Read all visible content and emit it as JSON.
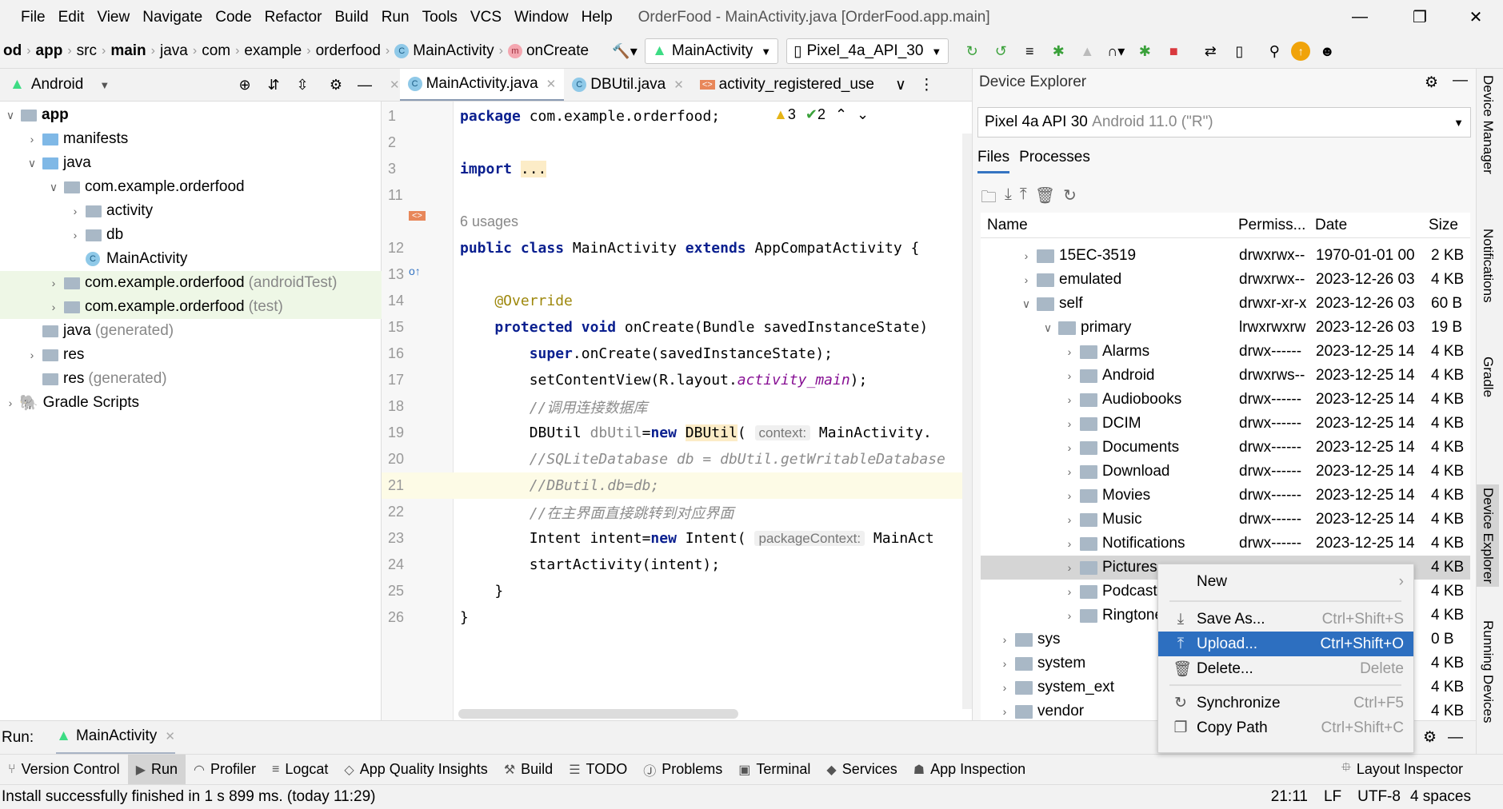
{
  "menu": [
    "File",
    "Edit",
    "View",
    "Navigate",
    "Code",
    "Refactor",
    "Build",
    "Run",
    "Tools",
    "VCS",
    "Window",
    "Help"
  ],
  "window_title": "OrderFood - MainActivity.java [OrderFood.app.main]",
  "breadcrumb": [
    "od",
    "app",
    "src",
    "main",
    "java",
    "com",
    "example",
    "orderfood",
    "MainActivity",
    "onCreate"
  ],
  "run_config": "MainActivity",
  "device": "Pixel_4a_API_30",
  "project": {
    "view": "Android",
    "tree": [
      {
        "label": "app",
        "depth": 0,
        "chev": "open",
        "icon": "module",
        "bold": true
      },
      {
        "label": "manifests",
        "depth": 1,
        "chev": "closed",
        "icon": "folder-blue"
      },
      {
        "label": "java",
        "depth": 1,
        "chev": "open",
        "icon": "folder-blue"
      },
      {
        "label": "com.example.orderfood",
        "depth": 2,
        "chev": "open",
        "icon": "package"
      },
      {
        "label": "activity",
        "depth": 3,
        "chev": "closed",
        "icon": "package"
      },
      {
        "label": "db",
        "depth": 3,
        "chev": "closed",
        "icon": "package"
      },
      {
        "label": "MainActivity",
        "depth": 3,
        "chev": "",
        "icon": "class"
      },
      {
        "label": "com.example.orderfood",
        "suffix": "(androidTest)",
        "depth": 2,
        "chev": "closed",
        "icon": "package",
        "hl": true
      },
      {
        "label": "com.example.orderfood",
        "suffix": "(test)",
        "depth": 2,
        "chev": "closed",
        "icon": "package",
        "hl": true
      },
      {
        "label": "java",
        "suffix": "(generated)",
        "depth": 1,
        "chev": "",
        "icon": "folder-gen"
      },
      {
        "label": "res",
        "depth": 1,
        "chev": "closed",
        "icon": "folder-res"
      },
      {
        "label": "res",
        "suffix": "(generated)",
        "depth": 1,
        "chev": "",
        "icon": "folder-res"
      },
      {
        "label": "Gradle Scripts",
        "depth": 0,
        "chev": "closed",
        "icon": "gradle"
      }
    ]
  },
  "editor": {
    "tabs": [
      {
        "label": "MainActivity.java",
        "active": true
      },
      {
        "label": "DBUtil.java"
      },
      {
        "label": "activity_registered_use"
      }
    ],
    "inspections": {
      "warnings": "3",
      "ok": "2"
    },
    "lines": [
      {
        "n": "1",
        "t": [
          [
            "package ",
            "kw"
          ],
          [
            "com.example.orderfood;",
            ""
          ]
        ]
      },
      {
        "n": "2",
        "t": []
      },
      {
        "n": "3",
        "t": [
          [
            "import ",
            "kw"
          ],
          [
            "...",
            "hlw"
          ]
        ]
      },
      {
        "n": "11",
        "t": []
      },
      {
        "n": "",
        "t": [
          [
            "6 usages",
            "usage"
          ]
        ]
      },
      {
        "n": "12",
        "t": [
          [
            "public ",
            "kw"
          ],
          [
            "class ",
            "kw"
          ],
          [
            "MainActivity ",
            ""
          ],
          [
            "extends ",
            "kw"
          ],
          [
            "AppCompatActivity {",
            ""
          ]
        ]
      },
      {
        "n": "13",
        "t": []
      },
      {
        "n": "14",
        "t": [
          [
            "    @Override",
            "ann"
          ]
        ]
      },
      {
        "n": "15",
        "t": [
          [
            "    ",
            ""
          ],
          [
            "protected ",
            "kw"
          ],
          [
            "void ",
            "kw"
          ],
          [
            "onCreate(Bundle savedInstanceState)",
            ""
          ]
        ]
      },
      {
        "n": "16",
        "t": [
          [
            "        ",
            ""
          ],
          [
            "super",
            "kw"
          ],
          [
            ".onCreate(savedInstanceState);",
            ""
          ]
        ]
      },
      {
        "n": "17",
        "t": [
          [
            "        setContentView(R.layout.",
            ""
          ],
          [
            "activity_main",
            "fld"
          ],
          [
            ");",
            ""
          ]
        ]
      },
      {
        "n": "18",
        "t": [
          [
            "        //调用连接数据库",
            "cmt"
          ]
        ]
      },
      {
        "n": "19",
        "t": [
          [
            "        DBUtil ",
            ""
          ],
          [
            "dbUtil",
            "var"
          ],
          [
            "=",
            ""
          ],
          [
            "new ",
            "kw"
          ],
          [
            "DBUtil",
            "hlw"
          ],
          [
            "( ",
            ""
          ],
          [
            "context:",
            "hint"
          ],
          [
            " MainActivity.",
            ""
          ]
        ]
      },
      {
        "n": "20",
        "t": [
          [
            "        //SQLiteDatabase db = dbUtil.getWritableDatabase",
            "cmt"
          ]
        ]
      },
      {
        "n": "21",
        "t": [
          [
            "        //DButil.db=db;",
            "cmt"
          ]
        ],
        "cur": true
      },
      {
        "n": "22",
        "t": [
          [
            "        //在主界面直接跳转到对应界面",
            "cmt"
          ]
        ]
      },
      {
        "n": "23",
        "t": [
          [
            "        Intent intent=",
            ""
          ],
          [
            "new ",
            "kw"
          ],
          [
            "Intent( ",
            ""
          ],
          [
            "packageContext:",
            "hint"
          ],
          [
            " MainAct",
            ""
          ]
        ]
      },
      {
        "n": "24",
        "t": [
          [
            "        startActivity(intent);",
            ""
          ]
        ]
      },
      {
        "n": "25",
        "t": [
          [
            "    }",
            ""
          ]
        ]
      },
      {
        "n": "26",
        "t": [
          [
            "}",
            ""
          ]
        ]
      }
    ]
  },
  "device_explorer": {
    "title": "Device Explorer",
    "device": "Pixel 4a API 30",
    "device_os": "Android 11.0 (\"R\")",
    "tabs": [
      "Files",
      "Processes"
    ],
    "columns": [
      "Name",
      "Permiss...",
      "Date",
      "Size"
    ],
    "rows": [
      {
        "name": "15EC-3519",
        "depth": 0,
        "chev": "closed",
        "perm": "drwxrwx--",
        "date": "1970-01-01 00",
        "size": "2 KB"
      },
      {
        "name": "emulated",
        "depth": 0,
        "chev": "closed",
        "perm": "drwxrwx--",
        "date": "2023-12-26 03",
        "size": "4 KB"
      },
      {
        "name": "self",
        "depth": 0,
        "chev": "open",
        "perm": "drwxr-xr-x",
        "date": "2023-12-26 03",
        "size": "60 B"
      },
      {
        "name": "primary",
        "depth": 1,
        "chev": "open",
        "perm": "lrwxrwxrw",
        "date": "2023-12-26 03",
        "size": "19 B",
        "link": true
      },
      {
        "name": "Alarms",
        "depth": 2,
        "chev": "closed",
        "perm": "drwx------",
        "date": "2023-12-25 14",
        "size": "4 KB"
      },
      {
        "name": "Android",
        "depth": 2,
        "chev": "closed",
        "perm": "drwxrws--",
        "date": "2023-12-25 14",
        "size": "4 KB"
      },
      {
        "name": "Audiobooks",
        "depth": 2,
        "chev": "closed",
        "perm": "drwx------",
        "date": "2023-12-25 14",
        "size": "4 KB"
      },
      {
        "name": "DCIM",
        "depth": 2,
        "chev": "closed",
        "perm": "drwx------",
        "date": "2023-12-25 14",
        "size": "4 KB"
      },
      {
        "name": "Documents",
        "depth": 2,
        "chev": "closed",
        "perm": "drwx------",
        "date": "2023-12-25 14",
        "size": "4 KB"
      },
      {
        "name": "Download",
        "depth": 2,
        "chev": "closed",
        "perm": "drwx------",
        "date": "2023-12-25 14",
        "size": "4 KB"
      },
      {
        "name": "Movies",
        "depth": 2,
        "chev": "closed",
        "perm": "drwx------",
        "date": "2023-12-25 14",
        "size": "4 KB"
      },
      {
        "name": "Music",
        "depth": 2,
        "chev": "closed",
        "perm": "drwx------",
        "date": "2023-12-25 14",
        "size": "4 KB"
      },
      {
        "name": "Notifications",
        "depth": 2,
        "chev": "closed",
        "perm": "drwx------",
        "date": "2023-12-25 14",
        "size": "4 KB"
      },
      {
        "name": "Pictures",
        "depth": 2,
        "chev": "closed",
        "perm": "",
        "date": "",
        "size": "4 KB",
        "selected": true
      },
      {
        "name": "Podcasts",
        "depth": 2,
        "chev": "closed",
        "perm": "",
        "date": "",
        "size": "4 KB"
      },
      {
        "name": "Ringtones",
        "depth": 2,
        "chev": "closed",
        "perm": "",
        "date": "",
        "size": "4 KB"
      },
      {
        "name": "sys",
        "depth": -1,
        "chev": "closed",
        "perm": "",
        "date": "",
        "size": "0 B"
      },
      {
        "name": "system",
        "depth": -1,
        "chev": "closed",
        "perm": "",
        "date": "",
        "size": "4 KB"
      },
      {
        "name": "system_ext",
        "depth": -1,
        "chev": "closed",
        "perm": "",
        "date": "",
        "size": "4 KB"
      },
      {
        "name": "vendor",
        "depth": -1,
        "chev": "closed",
        "perm": "",
        "date": "",
        "size": "4 KB"
      }
    ]
  },
  "context_menu": [
    {
      "label": "New",
      "shortcut": "",
      "icon": "",
      "submenu": true
    },
    {
      "sep": true
    },
    {
      "label": "Save As...",
      "shortcut": "Ctrl+Shift+S",
      "icon": "download-icon"
    },
    {
      "label": "Upload...",
      "shortcut": "Ctrl+Shift+O",
      "icon": "upload-icon",
      "active": true
    },
    {
      "label": "Delete...",
      "shortcut": "Delete",
      "icon": "trash-icon"
    },
    {
      "sep": true
    },
    {
      "label": "Synchronize",
      "shortcut": "Ctrl+F5",
      "icon": "sync-icon"
    },
    {
      "label": "Copy Path",
      "shortcut": "Ctrl+Shift+C",
      "icon": "copy-icon"
    }
  ],
  "right_strip": [
    "Device Manager",
    "Notifications",
    "Gradle",
    "Device Explorer",
    "Running Devices"
  ],
  "run": {
    "label": "Run:",
    "tab": "MainActivity"
  },
  "tool_strip": [
    {
      "label": "Version Control",
      "icon": "branch-icon"
    },
    {
      "label": "Run",
      "icon": "run-icon",
      "on": true
    },
    {
      "label": "Profiler",
      "icon": "profiler-icon"
    },
    {
      "label": "Logcat",
      "icon": "logcat-icon"
    },
    {
      "label": "App Quality Insights",
      "icon": "diamond-icon"
    },
    {
      "label": "Build",
      "icon": "hammer-icon"
    },
    {
      "label": "TODO",
      "icon": "list-icon"
    },
    {
      "label": "Problems",
      "icon": "problems-icon"
    },
    {
      "label": "Terminal",
      "icon": "terminal-icon"
    },
    {
      "label": "Services",
      "icon": "services-icon"
    },
    {
      "label": "App Inspection",
      "icon": "inspection-icon"
    }
  ],
  "layout_inspector": "Layout Inspector",
  "status": {
    "message": "Install successfully finished in 1 s 899 ms. (today 11:29)",
    "position": "21:11",
    "line_sep": "LF",
    "encoding": "UTF-8",
    "indent": "4 spaces"
  }
}
